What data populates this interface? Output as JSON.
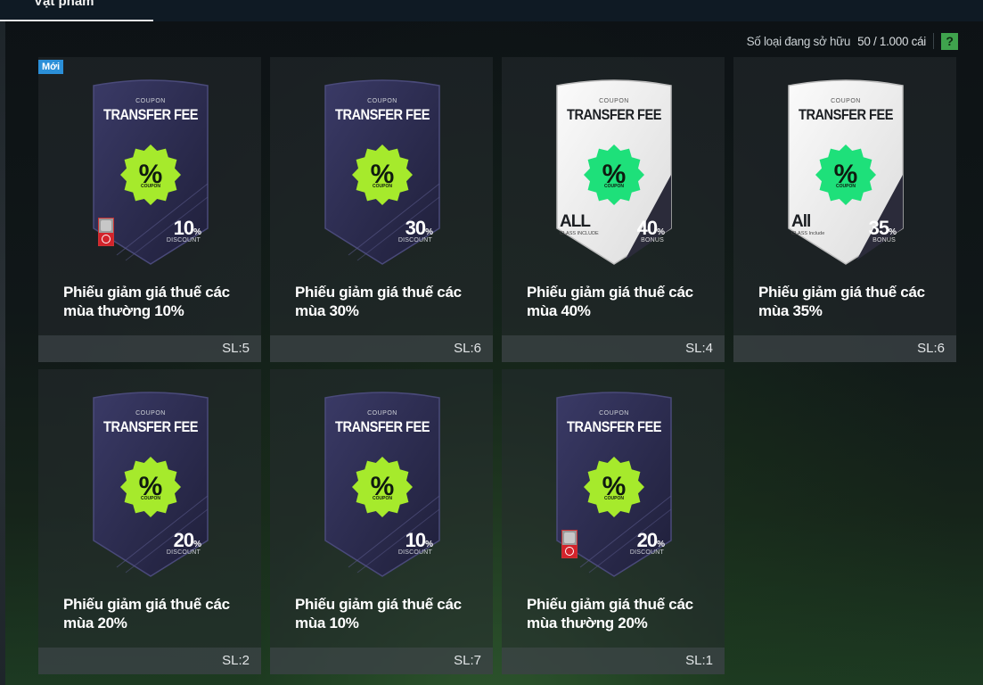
{
  "tab": {
    "label": "Vật phẩm"
  },
  "owned": {
    "label": "Số loại đang sở hữu",
    "count": "50 / 1.000 cái",
    "help": "?"
  },
  "items": [
    {
      "title": "Phiếu giảm giá thuế các mùa thường 10%",
      "qty": "SL:5",
      "new_badge": "Mới",
      "style": "dark",
      "coupon": "COUPON",
      "coupon_title": "TRANSFER FEE",
      "pct_symbol": "%",
      "pct_label": "COUPON",
      "value": "10",
      "value_unit": "%",
      "value_sub": "DISCOUNT",
      "locked": true
    },
    {
      "title": "Phiếu giảm giá thuế các mùa 30%",
      "qty": "SL:6",
      "style": "dark",
      "coupon": "COUPON",
      "coupon_title": "TRANSFER FEE",
      "pct_symbol": "%",
      "pct_label": "COUPON",
      "value": "30",
      "value_unit": "%",
      "value_sub": "DISCOUNT",
      "locked": false
    },
    {
      "title": "Phiếu giảm giá thuế các mùa 40%",
      "qty": "SL:4",
      "style": "light",
      "coupon": "COUPON",
      "coupon_title": "TRANSFER FEE",
      "pct_symbol": "%",
      "pct_label": "COUPON",
      "value": "40",
      "value_unit": "%",
      "value_sub": "BONUS",
      "class_label": "ALL",
      "class_sub": "CLASS INCLUDE",
      "locked": false
    },
    {
      "title": "Phiếu giảm giá thuế các mùa 35%",
      "qty": "SL:6",
      "style": "light",
      "coupon": "COUPON",
      "coupon_title": "TRANSFER FEE",
      "pct_symbol": "%",
      "pct_label": "COUPON",
      "value": "35",
      "value_unit": "%",
      "value_sub": "BONUS",
      "class_label": "All",
      "class_sub": "CLASS Include",
      "locked": false
    },
    {
      "title": "Phiếu giảm giá thuế các mùa 20%",
      "qty": "SL:2",
      "style": "dark",
      "coupon": "COUPON",
      "coupon_title": "TRANSFER FEE",
      "pct_symbol": "%",
      "pct_label": "COUPON",
      "value": "20",
      "value_unit": "%",
      "value_sub": "DISCOUNT",
      "locked": false
    },
    {
      "title": "Phiếu giảm giá thuế các mùa 10%",
      "qty": "SL:7",
      "style": "dark",
      "coupon": "COUPON",
      "coupon_title": "TRANSFER FEE",
      "pct_symbol": "%",
      "pct_label": "COUPON",
      "value": "10",
      "value_unit": "%",
      "value_sub": "DISCOUNT",
      "locked": false
    },
    {
      "title": "Phiếu giảm giá thuế các mùa thường 20%",
      "qty": "SL:1",
      "style": "dark",
      "coupon": "COUPON",
      "coupon_title": "TRANSFER FEE",
      "pct_symbol": "%",
      "pct_label": "COUPON",
      "value": "20",
      "value_unit": "%",
      "value_sub": "DISCOUNT",
      "locked": true
    }
  ],
  "colors": {
    "badge_new": "#2b8fd8",
    "help_green": "#3fa34d",
    "seal_lime": "#a6ea2c",
    "seal_mint": "#1ee07a",
    "card_dark": "#2a2a4e"
  }
}
